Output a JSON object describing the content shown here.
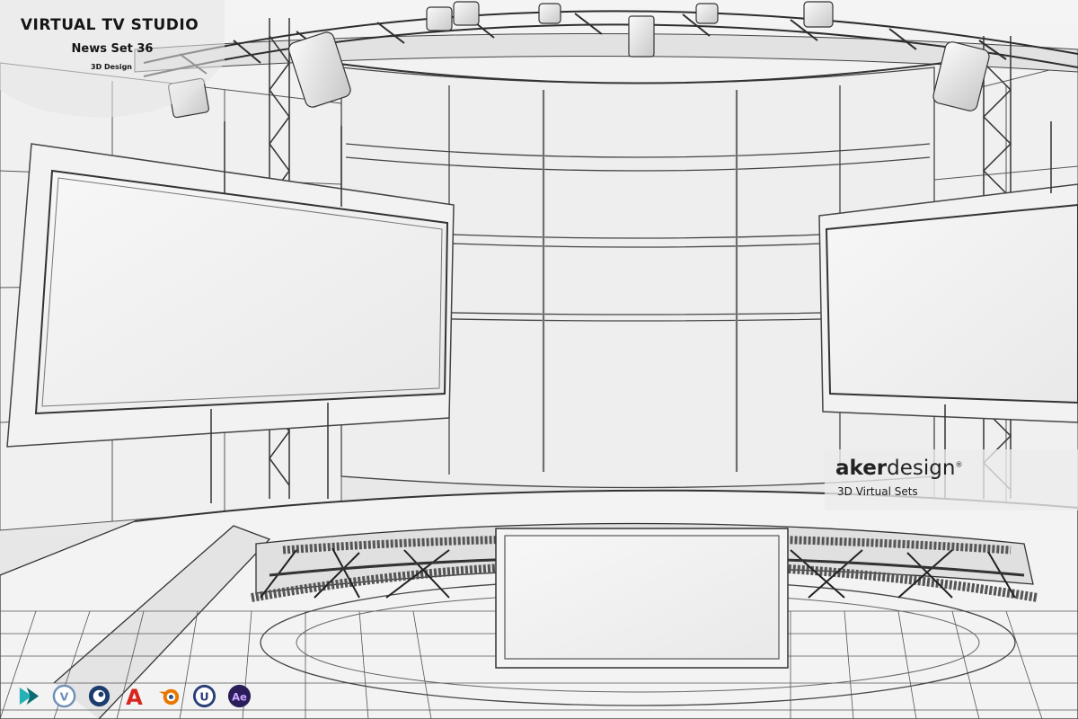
{
  "title": {
    "main": "VIRTUAL TV STUDIO",
    "subtitle": "News Set 36",
    "tag": "3D Design"
  },
  "brand": {
    "name_bold": "aker",
    "name_light": "design",
    "mark": "®",
    "tagline": "3D Virtual Sets"
  },
  "software_icons": [
    {
      "name": "3ds-max-icon",
      "glyph": "",
      "color": "#1aa0a8"
    },
    {
      "name": "vray-icon",
      "glyph": "V",
      "color": "#6f8fb8"
    },
    {
      "name": "cinema4d-icon",
      "glyph": "",
      "color": "#1d3c6e"
    },
    {
      "name": "autocad-icon",
      "glyph": "A",
      "color": "#d7261e"
    },
    {
      "name": "blender-icon",
      "glyph": "",
      "color": "#ea7600"
    },
    {
      "name": "unreal-engine-icon",
      "glyph": "U",
      "color": "#2a3e78"
    },
    {
      "name": "after-effects-icon",
      "glyph": "Ae",
      "color": "#2a1d5a"
    }
  ],
  "colors": {
    "background": "#ededed",
    "line": "#2a2a2a",
    "truss": "#3a3a3a",
    "screen": "#f3f3f3"
  }
}
